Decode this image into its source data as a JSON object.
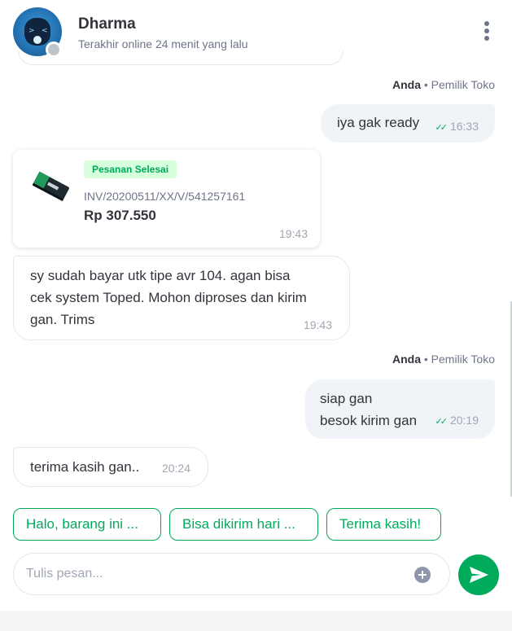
{
  "header": {
    "contact_name": "Dharma",
    "status_text": "Terakhir online 24 menit yang lalu"
  },
  "messages": [
    {
      "sender_name": "Anda",
      "sender_role": "• Pemilik Toko",
      "text": "iya gak ready",
      "time": "16:33"
    },
    {
      "order": {
        "badge": "Pesanan Selesai",
        "invoice": "INV/20200511/XX/V/541257161",
        "price": "Rp 307.550",
        "time": "19:43"
      }
    },
    {
      "lines": [
        "sy sudah bayar utk tipe avr 104. agan bisa",
        "cek system Toped. Mohon diproses dan kirim",
        "gan. Trims"
      ],
      "time": "19:43"
    },
    {
      "sender_name": "Anda",
      "sender_role": "• Pemilik Toko",
      "lines": [
        "siap gan",
        "besok kirim gan"
      ],
      "time": "20:19"
    },
    {
      "text": "terima kasih gan..",
      "time": "20:24"
    }
  ],
  "quick_replies": [
    "Halo, barang ini ...",
    "Bisa dikirim hari ...",
    "Terima kasih!"
  ],
  "composer": {
    "placeholder": "Tulis pesan..."
  },
  "colors": {
    "accent": "#00aa5b",
    "bubble_out": "#f0f3f7",
    "badge_bg": "#d6ffde"
  },
  "icons": [
    "bot-avatar-icon",
    "kebab-menu-icon",
    "read-check-icon",
    "product-image-icon",
    "plus-icon",
    "send-icon"
  ]
}
